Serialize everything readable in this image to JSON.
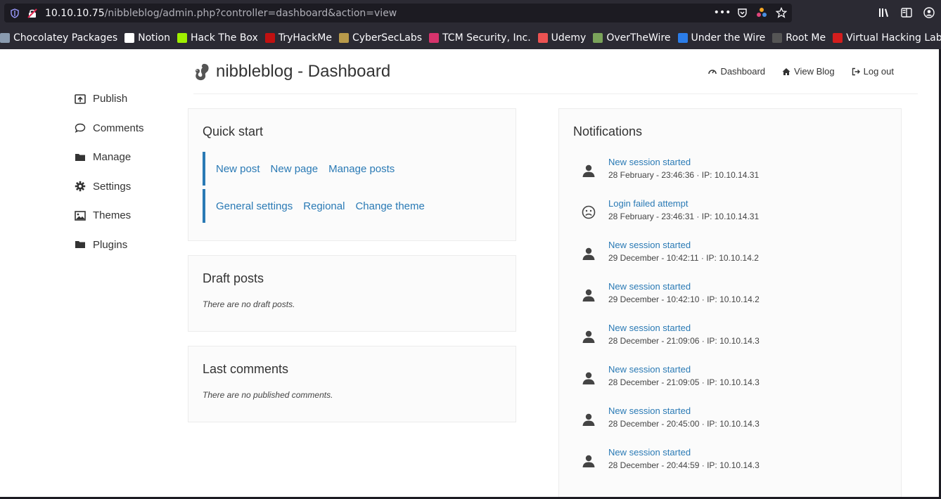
{
  "browser": {
    "url_host": "10.10.10.75",
    "url_path": "/nibbleblog/admin.php?controller=dashboard&action=view"
  },
  "bookmarks": [
    {
      "label": "Chocolatey Packages",
      "color": "#8a9bb0"
    },
    {
      "label": "Notion",
      "color": "#ffffff"
    },
    {
      "label": "Hack The Box",
      "color": "#9fef00"
    },
    {
      "label": "TryHackMe",
      "color": "#c11111"
    },
    {
      "label": "CyberSecLabs",
      "color": "#b89a4a"
    },
    {
      "label": "TCM Security, Inc.",
      "color": "#d6336c"
    },
    {
      "label": "Udemy",
      "color": "#ec5252"
    },
    {
      "label": "OverTheWire",
      "color": "#7aa35a"
    },
    {
      "label": "Under the Wire",
      "color": "#2b7de9"
    },
    {
      "label": "Root Me",
      "color": "#555555"
    },
    {
      "label": "Virtual Hacking Lab...",
      "color": "#d31d1d"
    }
  ],
  "sidebar": {
    "items": [
      {
        "label": "Publish",
        "icon": "publish-icon"
      },
      {
        "label": "Comments",
        "icon": "comment-icon"
      },
      {
        "label": "Manage",
        "icon": "folder-icon"
      },
      {
        "label": "Settings",
        "icon": "gear-icon"
      },
      {
        "label": "Themes",
        "icon": "image-icon"
      },
      {
        "label": "Plugins",
        "icon": "folder-icon"
      }
    ]
  },
  "header": {
    "title": "nibbleblog - Dashboard",
    "nav": [
      {
        "label": "Dashboard",
        "icon": "dashboard-icon"
      },
      {
        "label": "View Blog",
        "icon": "home-icon"
      },
      {
        "label": "Log out",
        "icon": "logout-icon"
      }
    ]
  },
  "quick_start": {
    "title": "Quick start",
    "row1": [
      "New post",
      "New page",
      "Manage posts"
    ],
    "row2": [
      "General settings",
      "Regional",
      "Change theme"
    ]
  },
  "drafts": {
    "title": "Draft posts",
    "empty": "There are no draft posts."
  },
  "last_comments": {
    "title": "Last comments",
    "empty": "There are no published comments."
  },
  "notifications": {
    "title": "Notifications",
    "items": [
      {
        "title": "New session started",
        "detail": "28 February - 23:46:36 · IP: 10.10.14.31",
        "icon": "user-icon"
      },
      {
        "title": "Login failed attempt",
        "detail": "28 February - 23:46:31 · IP: 10.10.14.31",
        "icon": "sad-face-icon"
      },
      {
        "title": "New session started",
        "detail": "29 December - 10:42:11 · IP: 10.10.14.2",
        "icon": "user-icon"
      },
      {
        "title": "New session started",
        "detail": "29 December - 10:42:10 · IP: 10.10.14.2",
        "icon": "user-icon"
      },
      {
        "title": "New session started",
        "detail": "28 December - 21:09:06 · IP: 10.10.14.3",
        "icon": "user-icon"
      },
      {
        "title": "New session started",
        "detail": "28 December - 21:09:05 · IP: 10.10.14.3",
        "icon": "user-icon"
      },
      {
        "title": "New session started",
        "detail": "28 December - 20:45:00 · IP: 10.10.14.3",
        "icon": "user-icon"
      },
      {
        "title": "New session started",
        "detail": "28 December - 20:44:59 · IP: 10.10.14.3",
        "icon": "user-icon"
      }
    ]
  }
}
